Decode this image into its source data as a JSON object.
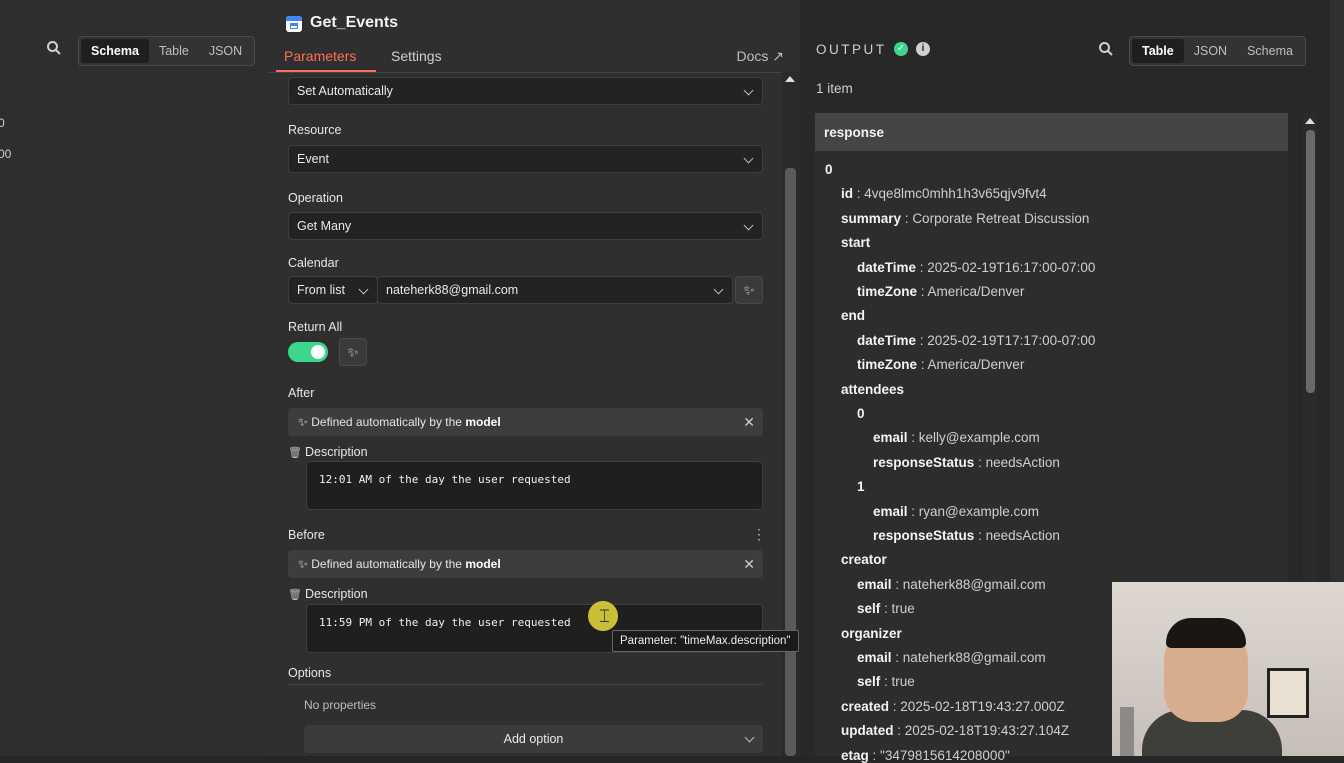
{
  "input_panel": {
    "views": [
      "Schema",
      "Table",
      "JSON"
    ],
    "active_view": "Schema",
    "fragments": [
      "0",
      "00"
    ]
  },
  "node": {
    "title": "Get_Events",
    "tabs": [
      "Parameters",
      "Settings"
    ],
    "docs_label": "Docs",
    "top_select": "Set Automatically",
    "resource_label": "Resource",
    "resource_value": "Event",
    "operation_label": "Operation",
    "operation_value": "Get Many",
    "calendar_label": "Calendar",
    "calendar_mode": "From list",
    "calendar_value": "nateherk88@gmail.com",
    "return_all_label": "Return All",
    "return_all_on": true,
    "after_label": "After",
    "after_defined": "Defined automatically by the",
    "after_defined_bold": "model",
    "after_desc_label": "Description",
    "after_desc_value": "12:01 AM of the day the user requested",
    "before_label": "Before",
    "before_defined": "Defined automatically by the",
    "before_defined_bold": "model",
    "before_desc_label": "Description",
    "before_desc_value": "11:59 PM of the day the user requested",
    "options_label": "Options",
    "no_properties": "No properties",
    "add_option_label": "Add option"
  },
  "tooltip": "Parameter: \"timeMax.description\"",
  "output": {
    "title": "OUTPUT",
    "views": [
      "Table",
      "JSON",
      "Schema"
    ],
    "active_view": "Table",
    "item_count": "1 item",
    "column": "response",
    "rows": [
      {
        "indent": 0,
        "key": "0",
        "value": ""
      },
      {
        "indent": 1,
        "key": "id",
        "value": "4vqe8lmc0mhh1h3v65qjv9fvt4"
      },
      {
        "indent": 1,
        "key": "summary",
        "value": "Corporate Retreat Discussion"
      },
      {
        "indent": 1,
        "key": "start",
        "value": ""
      },
      {
        "indent": 2,
        "key": "dateTime",
        "value": "2025-02-19T16:17:00-07:00"
      },
      {
        "indent": 2,
        "key": "timeZone",
        "value": "America/Denver"
      },
      {
        "indent": 1,
        "key": "end",
        "value": ""
      },
      {
        "indent": 2,
        "key": "dateTime",
        "value": "2025-02-19T17:17:00-07:00"
      },
      {
        "indent": 2,
        "key": "timeZone",
        "value": "America/Denver"
      },
      {
        "indent": 1,
        "key": "attendees",
        "value": ""
      },
      {
        "indent": 2,
        "key": "0",
        "value": ""
      },
      {
        "indent": 3,
        "key": "email",
        "value": "kelly@example.com"
      },
      {
        "indent": 3,
        "key": "responseStatus",
        "value": "needsAction"
      },
      {
        "indent": 2,
        "key": "1",
        "value": ""
      },
      {
        "indent": 3,
        "key": "email",
        "value": "ryan@example.com"
      },
      {
        "indent": 3,
        "key": "responseStatus",
        "value": "needsAction"
      },
      {
        "indent": 1,
        "key": "creator",
        "value": ""
      },
      {
        "indent": 2,
        "key": "email",
        "value": "nateherk88@gmail.com"
      },
      {
        "indent": 2,
        "key": "self",
        "value": "true"
      },
      {
        "indent": 1,
        "key": "organizer",
        "value": ""
      },
      {
        "indent": 2,
        "key": "email",
        "value": "nateherk88@gmail.com"
      },
      {
        "indent": 2,
        "key": "self",
        "value": "true"
      },
      {
        "indent": 1,
        "key": "created",
        "value": "2025-02-18T19:43:27.000Z"
      },
      {
        "indent": 1,
        "key": "updated",
        "value": "2025-02-18T19:43:27.104Z"
      },
      {
        "indent": 1,
        "key": "etag",
        "value": "\"3479815614208000\""
      }
    ]
  },
  "colors": {
    "accent": "#ff6d5a",
    "success": "#3dd68c",
    "panel": "#2f2f2f"
  }
}
